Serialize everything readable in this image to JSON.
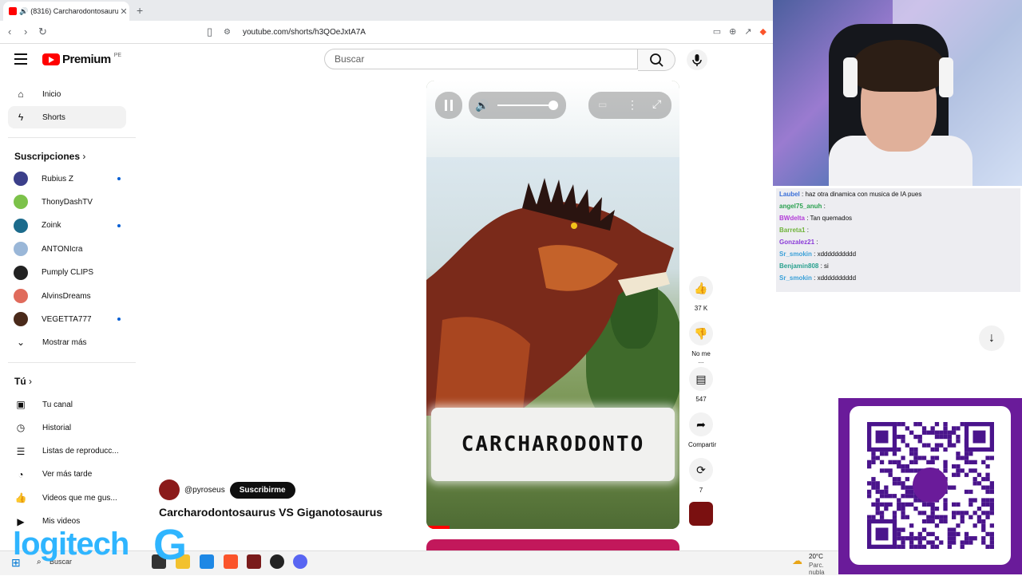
{
  "browser": {
    "tab_title": "(8316) Carcharodontosaurus",
    "url": "youtube.com/shorts/h3QOeJxtA7A"
  },
  "header": {
    "logo_text": "Premium",
    "country_code": "PE",
    "search_placeholder": "Buscar"
  },
  "sidebar": {
    "primary": [
      {
        "label": "Inicio",
        "icon": "home-icon"
      },
      {
        "label": "Shorts",
        "icon": "shorts-icon"
      }
    ],
    "subscriptions_title": "Suscripciones",
    "subscriptions": [
      {
        "name": "Rubius Z",
        "color": "#3b3f8a",
        "new": true
      },
      {
        "name": "ThonyDashTV",
        "color": "#7cc24a",
        "new": false
      },
      {
        "name": "Zoink",
        "color": "#1c6b8c",
        "new": true
      },
      {
        "name": "ANTONIcra",
        "color": "#9ab7d8",
        "new": false
      },
      {
        "name": "Pumply CLIPS",
        "color": "#222222",
        "new": false
      },
      {
        "name": "AlvinsDreams",
        "color": "#e06b5c",
        "new": false
      },
      {
        "name": "VEGETTA777",
        "color": "#4a2a1a",
        "new": true
      }
    ],
    "show_more": "Mostrar más",
    "you_title": "Tú",
    "you_items": [
      {
        "label": "Tu canal",
        "icon": "account-icon"
      },
      {
        "label": "Historial",
        "icon": "history-icon"
      },
      {
        "label": "Listas de reproducc...",
        "icon": "playlist-icon"
      },
      {
        "label": "Ver más tarde",
        "icon": "clock-icon"
      },
      {
        "label": "Videos que me gus...",
        "icon": "like-icon"
      },
      {
        "label": "Mis videos",
        "icon": "video-icon"
      }
    ]
  },
  "short": {
    "caption": "CARCHARODONTO",
    "channel": "@pyroseus",
    "subscribe_label": "Suscribirme",
    "title": "Carcharodontosaurus VS Giganotosaurus",
    "progress": 0.09
  },
  "actions": {
    "likes": "37 K",
    "dislike_label": "No me ...",
    "comments": "547",
    "share_label": "Compartir",
    "remix_count": "7"
  },
  "chat": [
    {
      "user": "Laubel",
      "msg": "haz otra dinamica con musica de IA pues",
      "color": "#3a6fd8"
    },
    {
      "user": "angel75_anuh",
      "msg": "",
      "color": "#2aa14f"
    },
    {
      "user": "BWdelta",
      "msg": "Tan quemados",
      "color": "#b23ad8"
    },
    {
      "user": "Barreta1",
      "msg": "",
      "color": "#6fb33a"
    },
    {
      "user": "Gonzalez21",
      "msg": "",
      "color": "#8a3ad8"
    },
    {
      "user": "Sr_smokin",
      "msg": "xdddddddddd",
      "color": "#3aa0d8"
    },
    {
      "user": "Benjamin808",
      "msg": "si",
      "color": "#2aa18f"
    },
    {
      "user": "Sr_smokin",
      "msg": "xdddddddddd",
      "color": "#3aa0d8"
    }
  ],
  "overlay": {
    "logitech_text": "logitech",
    "taskbar_search": "Buscar",
    "weather_temp": "20°C",
    "weather_desc": "Parc. nubla"
  }
}
